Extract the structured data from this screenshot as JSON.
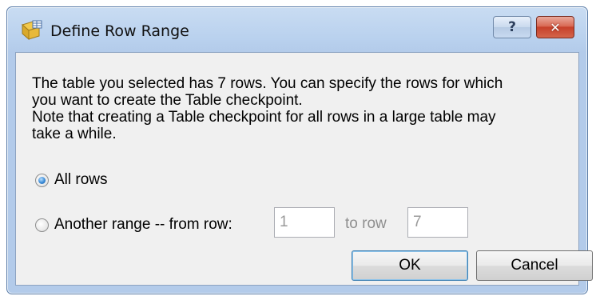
{
  "window": {
    "title": "Define Row Range",
    "help_label": "?",
    "close_label": "✕"
  },
  "message": {
    "line1": "The table you selected has 7  rows. You can specify the rows for which",
    "line2": "you want to create the Table checkpoint.",
    "line3": "Note that creating a Table checkpoint for all rows in a large table may",
    "line4": "take a while."
  },
  "options": {
    "all_rows_label": "All rows",
    "all_rows_selected": true,
    "another_range_label": "Another range -- from row:",
    "another_range_selected": false
  },
  "range": {
    "from_value": "1",
    "to_label": "to row",
    "to_value": "7"
  },
  "buttons": {
    "ok_label": "OK",
    "cancel_label": "Cancel"
  },
  "icons": {
    "title_icon": "table-checkpoint-icon",
    "help_icon": "help-icon",
    "close_icon": "close-icon"
  },
  "colors": {
    "title_bar": "#b9d1ee",
    "close_button": "#c6402a",
    "client_background": "#f0f0f0",
    "ok_focus_border": "#3c7fb1"
  }
}
